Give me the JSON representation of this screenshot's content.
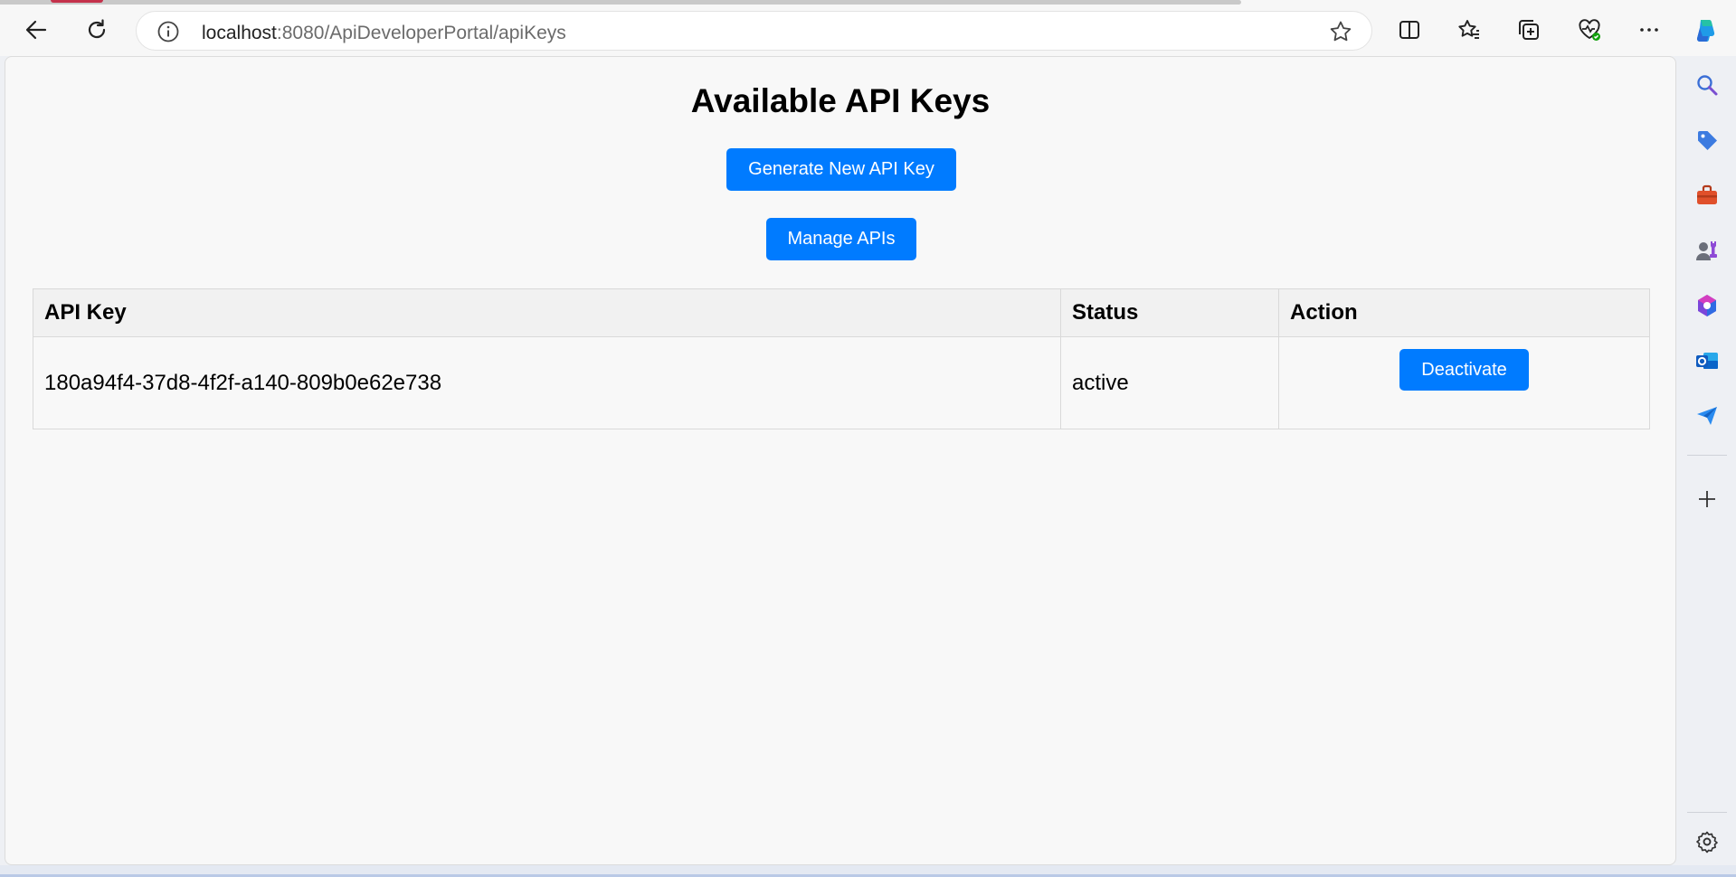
{
  "browser": {
    "url_host": "localhost",
    "url_rest": ":8080/ApiDeveloperPortal/apiKeys"
  },
  "page": {
    "title": "Available API Keys",
    "generate_button": "Generate New API Key",
    "manage_button": "Manage APIs"
  },
  "table": {
    "headers": [
      "API Key",
      "Status",
      "Action"
    ],
    "rows": [
      {
        "api_key": "180a94f4-37d8-4f2f-a140-809b0e62e738",
        "status": "active",
        "action": "Deactivate"
      }
    ]
  },
  "colors": {
    "primary_button": "#007bff",
    "page_background": "#f8f8f8"
  },
  "sidebar": {
    "icons": [
      "search-icon",
      "shopping-tag-icon",
      "toolbox-icon",
      "games-icon",
      "office-icon",
      "outlook-icon",
      "send-icon",
      "add-icon",
      "settings-icon"
    ]
  }
}
